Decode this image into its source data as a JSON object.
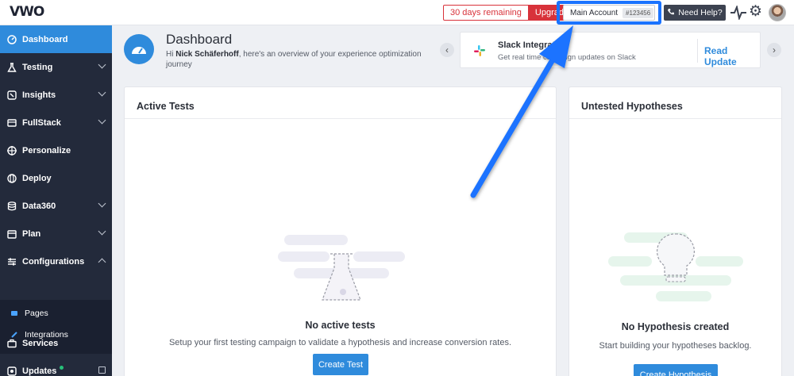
{
  "topbar": {
    "logo": "VWO",
    "trial_days": "30 days remaining",
    "upgrade": "Upgrade",
    "account_name": "Main Account",
    "account_id": "#123456",
    "help": "Need Help?"
  },
  "sidebar": {
    "items": [
      {
        "label": "Dashboard",
        "icon": "dashboard-icon"
      },
      {
        "label": "Testing",
        "icon": "flask-icon"
      },
      {
        "label": "Insights",
        "icon": "insights-icon"
      },
      {
        "label": "FullStack",
        "icon": "fullstack-icon"
      },
      {
        "label": "Personalize",
        "icon": "target-icon"
      },
      {
        "label": "Deploy",
        "icon": "deploy-icon"
      },
      {
        "label": "Data360",
        "icon": "database-icon"
      },
      {
        "label": "Plan",
        "icon": "calendar-icon"
      },
      {
        "label": "Configurations",
        "icon": "sliders-icon"
      },
      {
        "label": "Services",
        "icon": "briefcase-icon"
      },
      {
        "label": "Updates",
        "icon": "updates-icon"
      }
    ],
    "subitems": [
      {
        "label": "Pages",
        "icon": "page-icon"
      },
      {
        "label": "Integrations",
        "icon": "plug-icon"
      }
    ]
  },
  "header": {
    "title": "Dashboard",
    "greeting_prefix": "Hi ",
    "user_name": "Nick Schäferhoff",
    "greeting_suffix": ", here's an overview of your experience optimization journey"
  },
  "announcement": {
    "title": "Slack Integrat",
    "desc": "Get real time ca",
    "desc_hidden": "mpaign updates on Slack",
    "action": "Read Update"
  },
  "active_tests": {
    "title": "Active Tests",
    "empty_title": "No active tests",
    "empty_desc": "Setup your first testing campaign to validate a hypothesis and increase conversion rates.",
    "button": "Create Test"
  },
  "hypotheses": {
    "title": "Untested Hypotheses",
    "empty_title": "No Hypothesis created",
    "empty_desc": "Start building your hypotheses backlog.",
    "button": "Create Hypothesis"
  },
  "colors": {
    "accent": "#2f8bdc",
    "sidebar": "#232a3b",
    "danger": "#d8323a",
    "highlight": "#1a73ff"
  }
}
